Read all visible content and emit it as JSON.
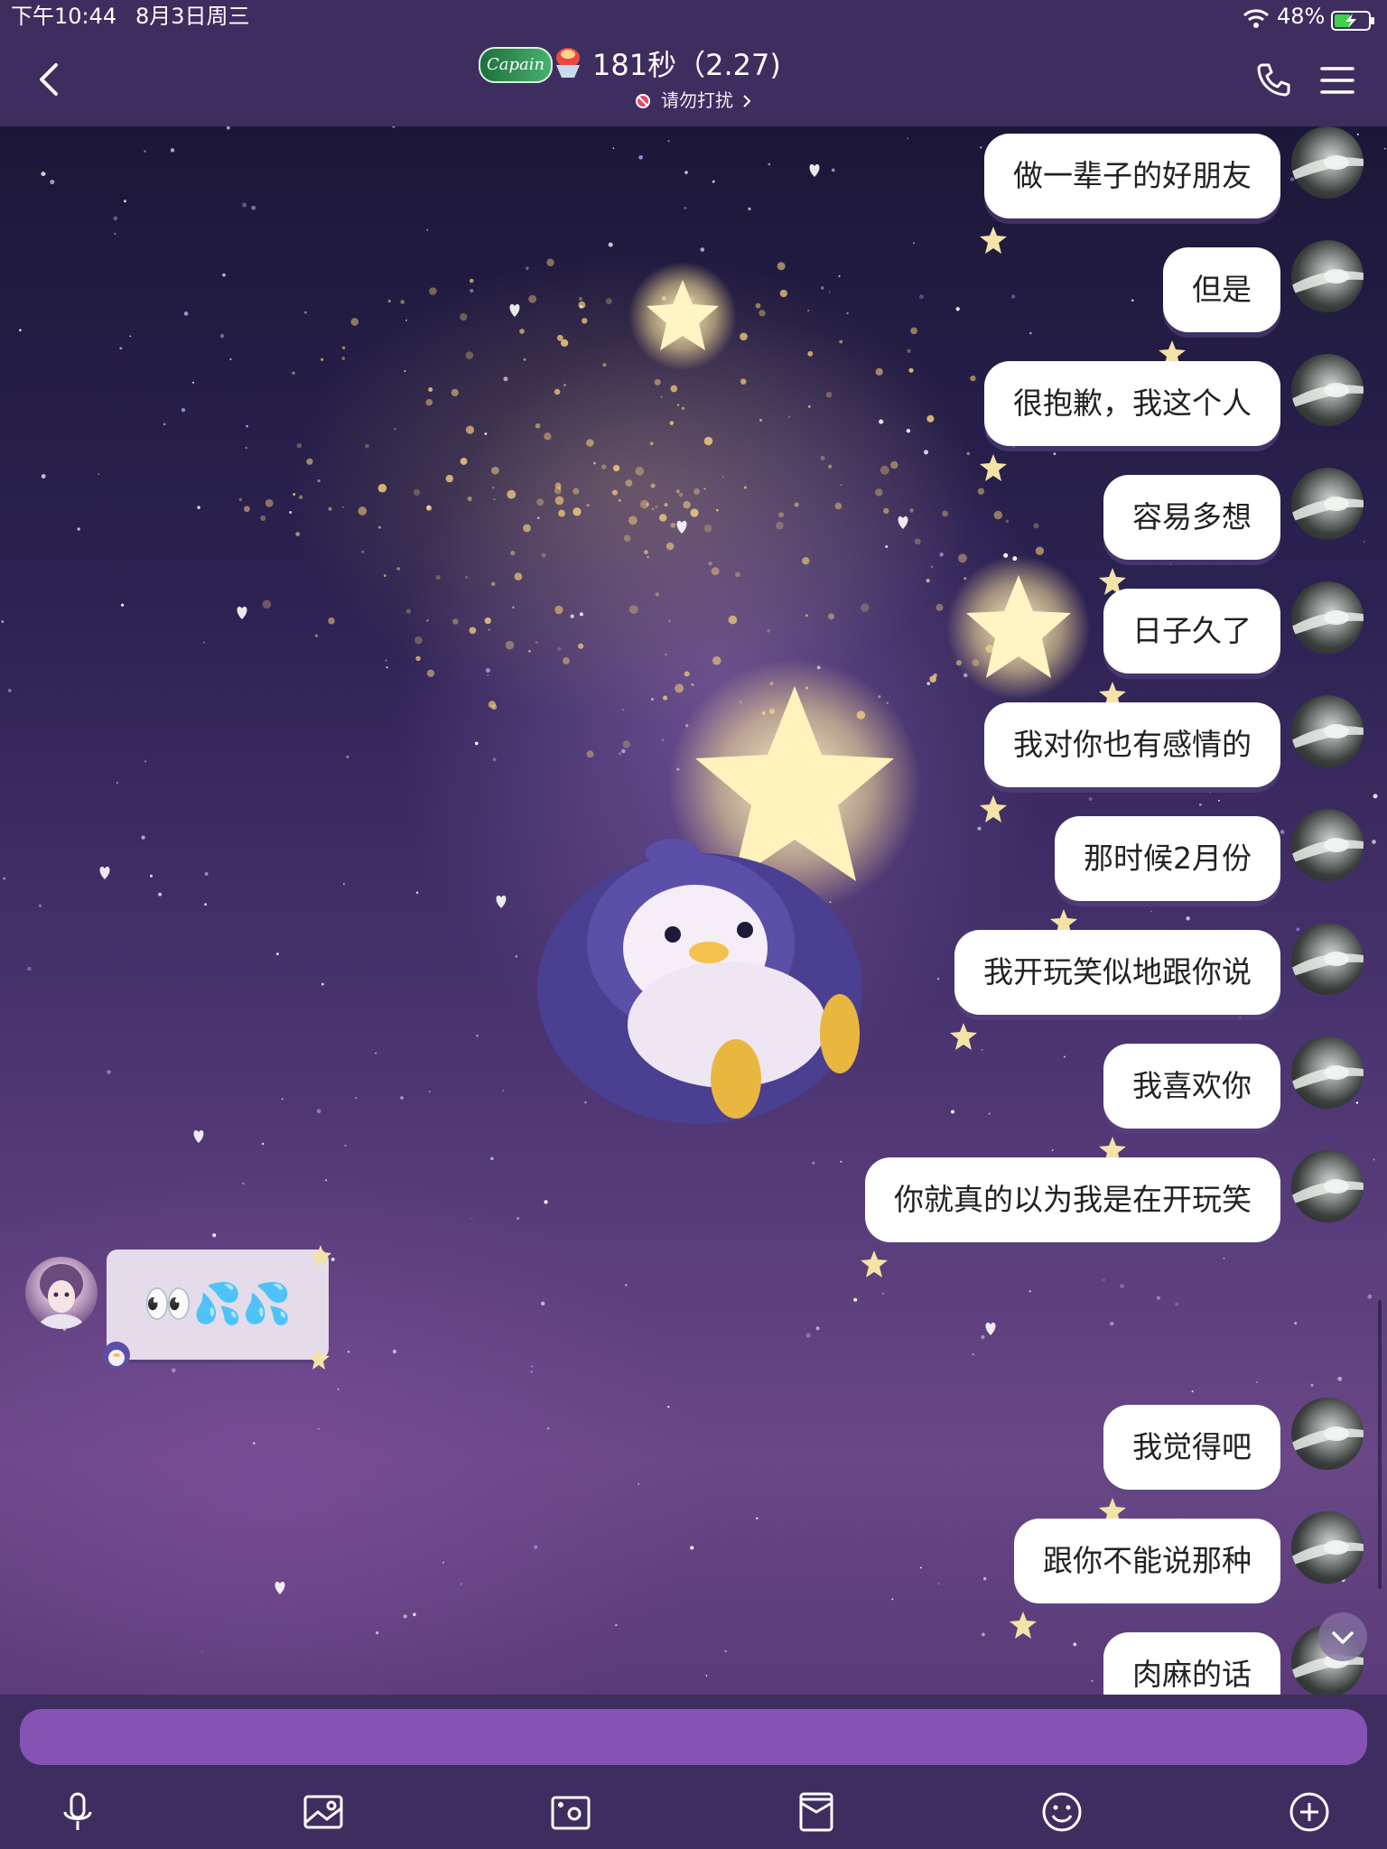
{
  "status_bar": {
    "time": "下午10:44",
    "date": "8月3日周三",
    "battery_percent": "48%",
    "battery_level": 0.48,
    "charging": true,
    "icons": [
      "wifi-icon",
      "battery-charging-icon"
    ]
  },
  "header": {
    "badge_text": "Capain",
    "title_emoji": "🍧",
    "title": "181秒（2.27)",
    "status_text": "请勿打扰",
    "icons": [
      "back-arrow-icon",
      "do-not-disturb-icon",
      "chevron-right-icon",
      "phone-icon",
      "menu-icon"
    ]
  },
  "messages_outgoing": [
    {
      "text": "做一辈子的好朋友"
    },
    {
      "text": "但是"
    },
    {
      "text": "很抱歉，我这个人"
    },
    {
      "text": "容易多想"
    },
    {
      "text": "日子久了"
    },
    {
      "text": "我对你也有感情的"
    },
    {
      "text": "那时候2月份"
    },
    {
      "text": "我开玩笑似地跟你说"
    },
    {
      "text": "我喜欢你"
    },
    {
      "text": "你就真的以为我是在开玩笑"
    },
    {
      "text": "我觉得吧"
    },
    {
      "text": "跟你不能说那种"
    },
    {
      "text": "肉麻的话"
    }
  ],
  "message_incoming": {
    "text": "👀💦💦"
  },
  "input": {
    "value": "",
    "placeholder": ""
  },
  "toolbar": {
    "icons": [
      "microphone-icon",
      "image-icon",
      "camera-icon",
      "red-packet-icon",
      "emoji-icon",
      "plus-icon"
    ]
  },
  "colors": {
    "header_bg": "#3d2e5f",
    "input_bg": "#8553b4",
    "bubble_out_bg": "#ffffff",
    "bubble_in_bg": "#e4dcea"
  }
}
